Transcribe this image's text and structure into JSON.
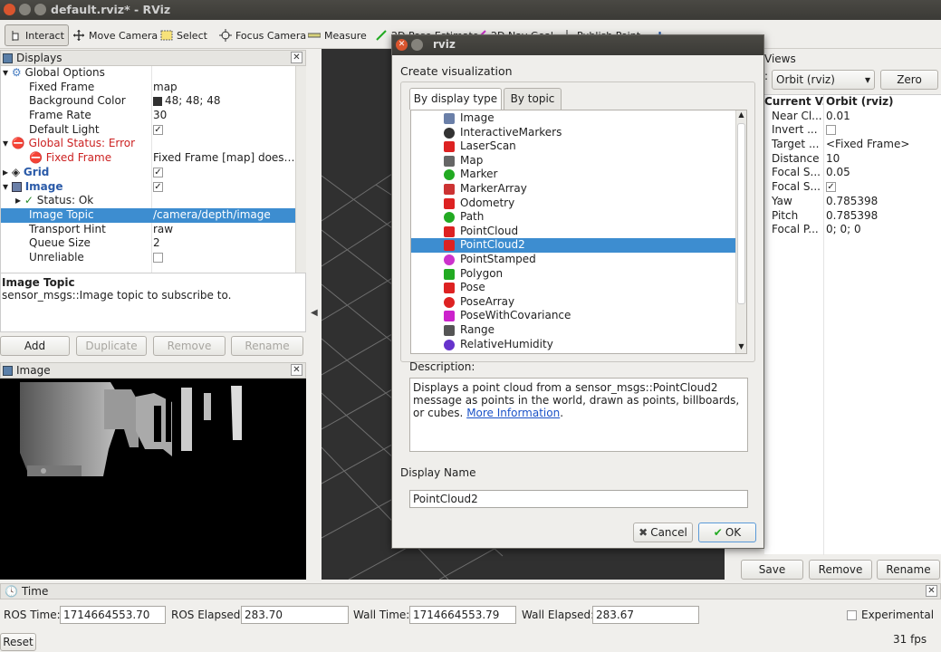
{
  "window": {
    "title": "default.rviz* - RViz"
  },
  "toolbar": [
    {
      "label": "Interact",
      "icon": "cursor-hand-icon"
    },
    {
      "label": "Move Camera",
      "icon": "move-camera-icon"
    },
    {
      "label": "Select",
      "icon": "select-rect-icon"
    },
    {
      "label": "Focus Camera",
      "icon": "focus-camera-icon"
    },
    {
      "label": "Measure",
      "icon": "ruler-icon"
    },
    {
      "label": "2D Pose Estimate",
      "icon": "pose-estimate-icon"
    },
    {
      "label": "2D Nav Goal",
      "icon": "nav-goal-icon"
    },
    {
      "label": "Publish Point",
      "icon": "publish-point-icon"
    }
  ],
  "displays": {
    "title": "Displays",
    "rows": [
      {
        "name": "Global Options",
        "value": ""
      },
      {
        "name": "Fixed Frame",
        "value": "map"
      },
      {
        "name": "Background Color",
        "value": "48; 48; 48"
      },
      {
        "name": "Frame Rate",
        "value": "30"
      },
      {
        "name": "Default Light",
        "value": "✓"
      },
      {
        "name": "Global Status: Error",
        "value": ""
      },
      {
        "name": "Fixed Frame",
        "value": "Fixed Frame [map] does ..."
      },
      {
        "name": "Grid",
        "value": "✓"
      },
      {
        "name": "Image",
        "value": "✓"
      },
      {
        "name": "Status: Ok",
        "value": ""
      },
      {
        "name": "Image Topic",
        "value": "/camera/depth/image"
      },
      {
        "name": "Transport Hint",
        "value": "raw"
      },
      {
        "name": "Queue Size",
        "value": "2"
      },
      {
        "name": "Unreliable",
        "value": ""
      }
    ],
    "desc_title": "Image Topic",
    "desc_text": "sensor_msgs::Image topic to subscribe to.",
    "buttons": {
      "add": "Add",
      "duplicate": "Duplicate",
      "remove": "Remove",
      "rename": "Rename"
    }
  },
  "image_panel": {
    "title": "Image"
  },
  "views": {
    "title": "Views",
    "type_value": "Orbit (rviz)",
    "zero": "Zero",
    "header": [
      "Current V...",
      "Orbit (rviz)"
    ],
    "rows": [
      {
        "name": "Near Cl...",
        "value": "0.01"
      },
      {
        "name": "Invert ...",
        "value": ""
      },
      {
        "name": "Target ...",
        "value": "<Fixed Frame>"
      },
      {
        "name": "Distance",
        "value": "10"
      },
      {
        "name": "Focal S...",
        "value": "0.05"
      },
      {
        "name": "Focal S...",
        "value": "✓"
      },
      {
        "name": "Yaw",
        "value": "0.785398"
      },
      {
        "name": "Pitch",
        "value": "0.785398"
      },
      {
        "name": "Focal P...",
        "value": "0; 0; 0"
      }
    ],
    "buttons": {
      "save": "Save",
      "remove": "Remove",
      "rename": "Rename"
    }
  },
  "time": {
    "title": "Time",
    "ros_time_label": "ROS Time:",
    "ros_time": "1714664553.70",
    "ros_elapsed_label": "ROS Elapsed:",
    "ros_elapsed": "283.70",
    "wall_time_label": "Wall Time:",
    "wall_time": "1714664553.79",
    "wall_elapsed_label": "Wall Elapsed:",
    "wall_elapsed": "283.67",
    "experimental": "Experimental",
    "reset": "Reset",
    "fps": "31 fps"
  },
  "dialog": {
    "title": "rviz",
    "heading": "Create visualization",
    "tabs": [
      "By display type",
      "By topic"
    ],
    "items": [
      {
        "label": "Image",
        "icon": "image-icon",
        "color": "#6a7fa8"
      },
      {
        "label": "InteractiveMarkers",
        "icon": "interactive-markers-icon",
        "color": "#333333"
      },
      {
        "label": "LaserScan",
        "icon": "laserscan-icon",
        "color": "#d22"
      },
      {
        "label": "Map",
        "icon": "map-icon",
        "color": "#666"
      },
      {
        "label": "Marker",
        "icon": "marker-icon",
        "color": "#2a2"
      },
      {
        "label": "MarkerArray",
        "icon": "marker-array-icon",
        "color": "#c33"
      },
      {
        "label": "Odometry",
        "icon": "odometry-icon",
        "color": "#d22"
      },
      {
        "label": "Path",
        "icon": "path-icon",
        "color": "#2a2"
      },
      {
        "label": "PointCloud",
        "icon": "pointcloud-icon",
        "color": "#d22"
      },
      {
        "label": "PointCloud2",
        "icon": "pointcloud2-icon",
        "color": "#d22"
      },
      {
        "label": "PointStamped",
        "icon": "point-stamped-icon",
        "color": "#c3c"
      },
      {
        "label": "Polygon",
        "icon": "polygon-icon",
        "color": "#2a2"
      },
      {
        "label": "Pose",
        "icon": "pose-icon",
        "color": "#d22"
      },
      {
        "label": "PoseArray",
        "icon": "pose-array-icon",
        "color": "#d22"
      },
      {
        "label": "PoseWithCovariance",
        "icon": "pose-covariance-icon",
        "color": "#c2c"
      },
      {
        "label": "Range",
        "icon": "range-icon",
        "color": "#555"
      },
      {
        "label": "RelativeHumidity",
        "icon": "humidity-icon",
        "color": "#63c"
      }
    ],
    "description_label": "Description:",
    "description_text": "Displays a point cloud from a sensor_msgs::PointCloud2 message as points in the world, drawn as points, billboards, or cubes. ",
    "description_link": "More Information",
    "description_end": ".",
    "display_name_label": "Display Name",
    "display_name_value": "PointCloud2",
    "cancel": "Cancel",
    "ok": "OK"
  }
}
